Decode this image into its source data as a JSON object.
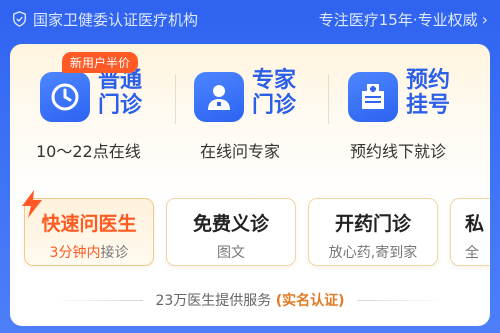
{
  "topbar": {
    "left_text": "国家卫健委认证医疗机构",
    "right_text": "专注医疗15年·专业权威"
  },
  "services": [
    {
      "title_line1": "普通",
      "title_line2": "门诊",
      "subtitle": "10～22点在线",
      "badge": "新用户半价",
      "icon": "clock-hand-icon"
    },
    {
      "title_line1": "专家",
      "title_line2": "门诊",
      "subtitle": "在线问专家",
      "icon": "doctor-icon"
    },
    {
      "title_line1": "预约",
      "title_line2": "挂号",
      "subtitle": "预约线下就诊",
      "icon": "hospital-icon"
    }
  ],
  "quick": [
    {
      "title": "快速问医生",
      "sub_highlight": "3分钟内",
      "sub_rest": "接诊"
    },
    {
      "title": "免费义诊",
      "sub": "图文"
    },
    {
      "title": "开药门诊",
      "sub": "放心药,寄到家"
    },
    {
      "title": "私",
      "sub": "全"
    }
  ],
  "footer": {
    "text": "23万医生提供服务",
    "verify": "(实名认证)"
  },
  "colors": {
    "primary_blue": "#2f63f0",
    "accent_orange": "#ff5a25",
    "card_cream": "#fff4de"
  }
}
